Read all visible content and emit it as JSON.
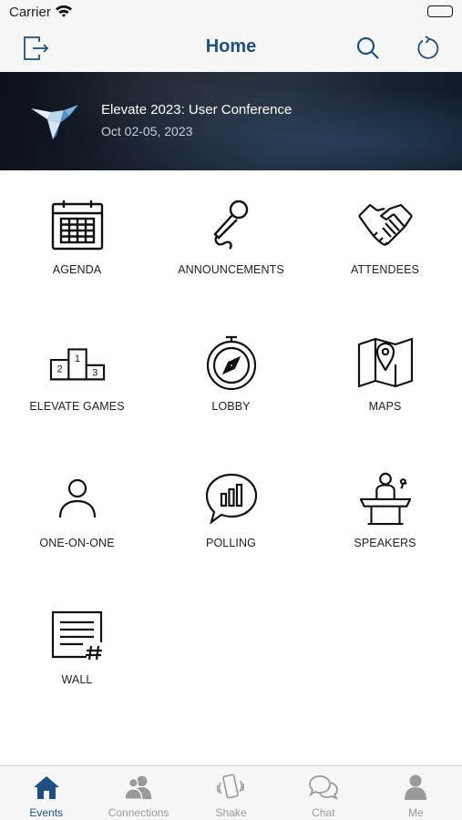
{
  "status_bar": {
    "carrier": "Carrier"
  },
  "nav": {
    "title": "Home"
  },
  "banner": {
    "title": "Elevate 2023: User Conference",
    "date": "Oct 02-05, 2023"
  },
  "tiles": [
    {
      "label": "AGENDA",
      "icon": "calendar-icon"
    },
    {
      "label": "ANNOUNCEMENTS",
      "icon": "microphone-icon"
    },
    {
      "label": "ATTENDEES",
      "icon": "handshake-icon"
    },
    {
      "label": "ELEVATE GAMES",
      "icon": "podium-icon"
    },
    {
      "label": "LOBBY",
      "icon": "compass-icon"
    },
    {
      "label": "MAPS",
      "icon": "map-pin-icon"
    },
    {
      "label": "ONE-ON-ONE",
      "icon": "person-icon"
    },
    {
      "label": "POLLING",
      "icon": "poll-chat-icon"
    },
    {
      "label": "SPEAKERS",
      "icon": "lectern-speaker-icon"
    },
    {
      "label": "WALL",
      "icon": "wall-post-icon"
    }
  ],
  "tabs": [
    {
      "label": "Events",
      "icon": "home-icon",
      "active": true
    },
    {
      "label": "Connections",
      "icon": "people-icon",
      "active": false
    },
    {
      "label": "Shake",
      "icon": "shake-phone-icon",
      "active": false
    },
    {
      "label": "Chat",
      "icon": "chat-bubbles-icon",
      "active": false
    },
    {
      "label": "Me",
      "icon": "user-icon",
      "active": false
    }
  ],
  "colors": {
    "accent": "#1f4f82",
    "tab_inactive": "#9a9a9a",
    "bar_bg": "#f7f7f7"
  }
}
